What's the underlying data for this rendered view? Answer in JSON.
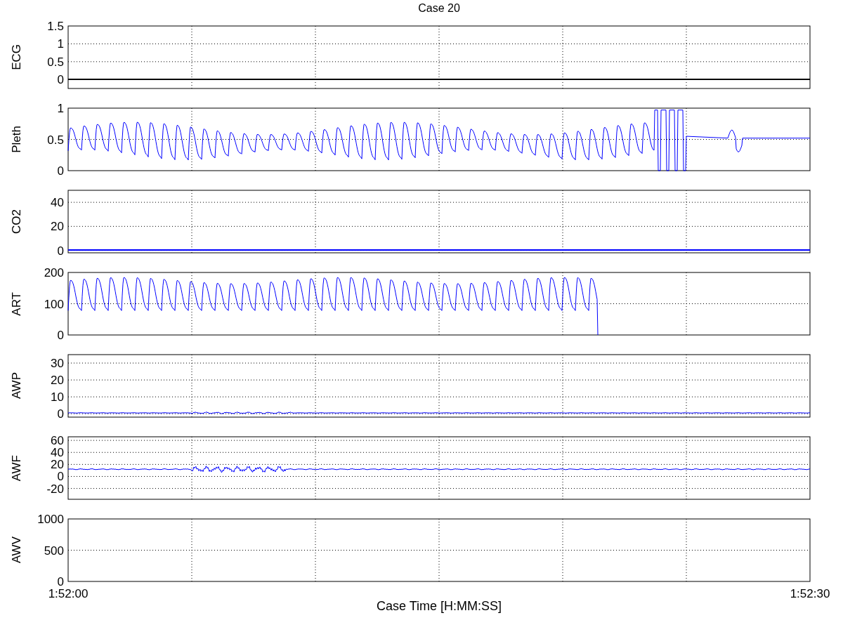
{
  "figure": {
    "title": "Case 20"
  },
  "panels": [
    {
      "kind": "ecg",
      "label": "ECG",
      "yticks": [
        "1.5",
        "1",
        "0.5",
        "0"
      ],
      "color": "#000000"
    },
    {
      "kind": "pleth",
      "label": "Pleth",
      "yticks": [
        "1",
        "0.5",
        "0"
      ],
      "color": "#0000ff"
    },
    {
      "kind": "co2",
      "label": "CO2",
      "yticks": [
        "40",
        "20",
        "0"
      ],
      "color": "#0000ff"
    },
    {
      "kind": "art",
      "label": "ART",
      "yticks": [
        "200",
        "100",
        "0"
      ],
      "color": "#0000ff"
    },
    {
      "kind": "awp",
      "label": "AWP",
      "yticks": [
        "30",
        "20",
        "10",
        "0"
      ],
      "color": "#0000ff"
    },
    {
      "kind": "awf",
      "label": "AWF",
      "yticks": [
        "60",
        "40",
        "20",
        "0",
        "-20"
      ],
      "color": "#0000ff"
    },
    {
      "kind": "awv",
      "label": "AWV",
      "yticks": [
        "1000",
        "500",
        "0"
      ]
    }
  ],
  "x_axis": {
    "label": "Case Time [H:MM:SS]",
    "ticks": [
      "1:52:00",
      "1:52:30"
    ]
  }
}
